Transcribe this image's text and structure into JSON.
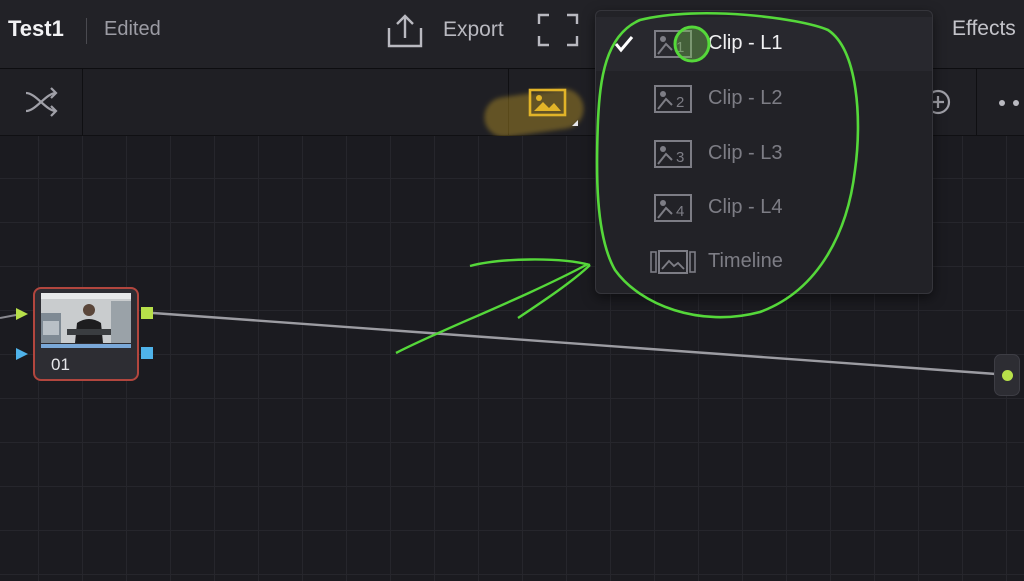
{
  "header": {
    "project_title": "Test1",
    "status": "Edited",
    "export_label": "Export",
    "effects_label": "Effects"
  },
  "node": {
    "label": "01"
  },
  "source_menu": {
    "items": [
      {
        "label": "Clip - L1",
        "number": "1",
        "selected": true
      },
      {
        "label": "Clip - L2",
        "number": "2",
        "selected": false
      },
      {
        "label": "Clip - L3",
        "number": "3",
        "selected": false
      },
      {
        "label": "Clip - L4",
        "number": "4",
        "selected": false
      },
      {
        "label": "Timeline",
        "selected": false
      }
    ]
  },
  "colors": {
    "background": "#1b1b20",
    "accent_yellow": "#e2b428",
    "node_border": "#b2463e",
    "port_green": "#b7e04a",
    "port_blue": "#4fb3ea",
    "annotation_green": "#55d83a"
  },
  "icons": {
    "export": "export-icon",
    "fullscreen": "fullscreen-icon",
    "shuffle": "shuffle-icon",
    "image_mode": "image-icon",
    "add": "add-circle-icon",
    "more": "more-icon",
    "checkmark": "checkmark-icon"
  }
}
